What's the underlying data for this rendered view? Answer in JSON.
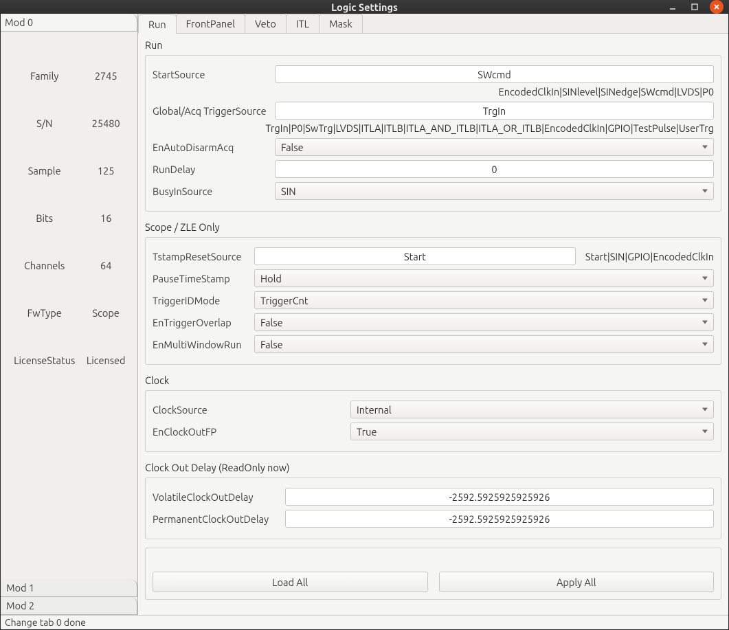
{
  "window": {
    "title": "Logic Settings"
  },
  "modules": {
    "tabs": [
      "Mod 0",
      "Mod 1",
      "Mod 2"
    ],
    "active": 0,
    "info": [
      {
        "key": "Family",
        "value": "2745"
      },
      {
        "key": "S/N",
        "value": "25480"
      },
      {
        "key": "Sample",
        "value": "125"
      },
      {
        "key": "Bits",
        "value": "16"
      },
      {
        "key": "Channels",
        "value": "64"
      },
      {
        "key": "FwType",
        "value": "Scope"
      },
      {
        "key": "LicenseStatus",
        "value": "Licensed"
      }
    ]
  },
  "subtabs": {
    "items": [
      "Run",
      "FrontPanel",
      "Veto",
      "ITL",
      "Mask"
    ],
    "active": 0
  },
  "run": {
    "title": "Run",
    "fields": {
      "StartSource": {
        "label": "StartSource",
        "value": "SWcmd",
        "hint": "EncodedClkIn|SINlevel|SINedge|SWcmd|LVDS|P0"
      },
      "GlobalAcqTriggerSource": {
        "label": "Global/Acq TriggerSource",
        "value": "TrgIn",
        "hint": "TrgIn|P0|SwTrg|LVDS|ITLA|ITLB|ITLA_AND_ITLB|ITLA_OR_ITLB|EncodedClkIn|GPIO|TestPulse|UserTrg"
      },
      "EnAutoDisarmAcq": {
        "label": "EnAutoDisarmAcq",
        "value": "False"
      },
      "RunDelay": {
        "label": "RunDelay",
        "value": "0"
      },
      "BusyInSource": {
        "label": "BusyInSource",
        "value": "SIN"
      }
    }
  },
  "scopeZle": {
    "title": "Scope / ZLE Only",
    "fields": {
      "TstampResetSource": {
        "label": "TstampResetSource",
        "value": "Start",
        "hint": "Start|SIN|GPIO|EncodedClkIn"
      },
      "PauseTimeStamp": {
        "label": "PauseTimeStamp",
        "value": "Hold"
      },
      "TriggerIDMode": {
        "label": "TriggerIDMode",
        "value": "TriggerCnt"
      },
      "EnTriggerOverlap": {
        "label": "EnTriggerOverlap",
        "value": "False"
      },
      "EnMultiWindowRun": {
        "label": "EnMultiWindowRun",
        "value": "False"
      }
    }
  },
  "clock": {
    "title": "Clock",
    "fields": {
      "ClockSource": {
        "label": "ClockSource",
        "value": "Internal"
      },
      "EnClockOutFP": {
        "label": "EnClockOutFP",
        "value": "True"
      }
    }
  },
  "clockDelay": {
    "title": "Clock Out Delay (ReadOnly now)",
    "fields": {
      "VolatileClockOutDelay": {
        "label": "VolatileClockOutDelay",
        "value": "-2592.5925925925926"
      },
      "PermanentClockOutDelay": {
        "label": "PermanentClockOutDelay",
        "value": "-2592.5925925925926"
      }
    }
  },
  "buttons": {
    "loadAll": "Load All",
    "applyAll": "Apply All"
  },
  "status": "Change tab 0 done"
}
